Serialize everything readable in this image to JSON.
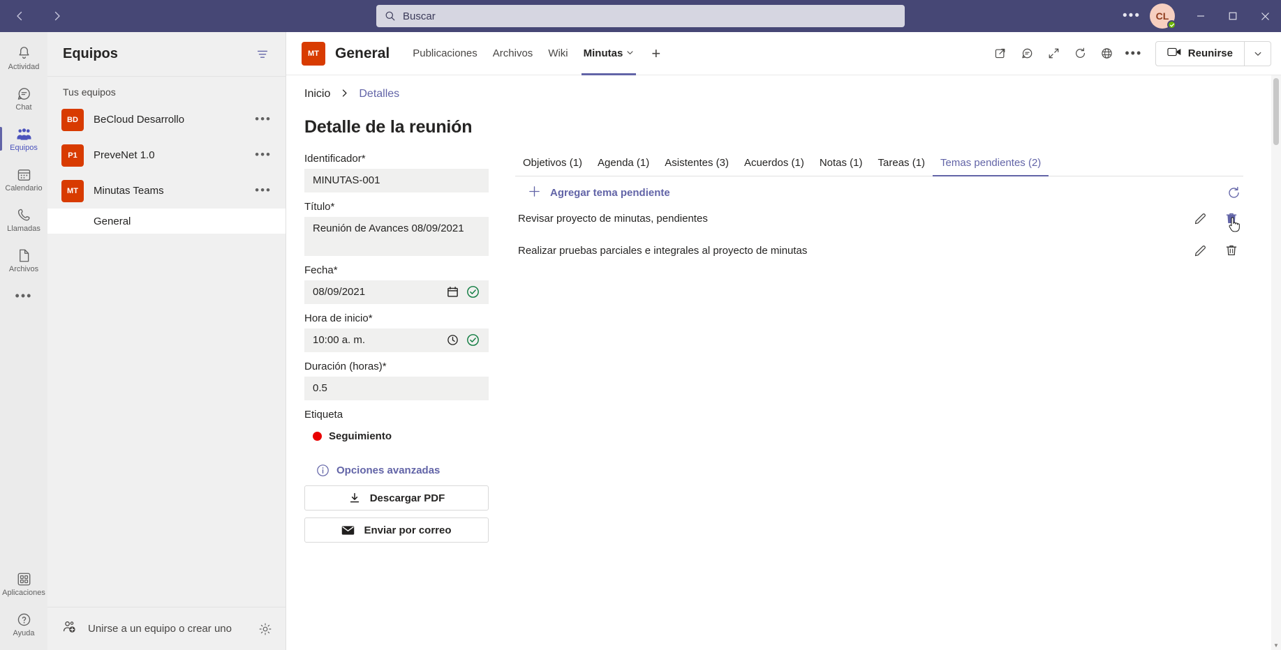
{
  "titlebar": {
    "back_icon": "chevron-left-icon",
    "forward_icon": "chevron-right-icon",
    "search_placeholder": "Buscar",
    "more_label": "•••",
    "avatar_initials": "CL",
    "presence": "available",
    "minimize_label": "—",
    "maximize_label": "□",
    "close_label": "✕"
  },
  "rail": {
    "items": [
      {
        "label": "Actividad",
        "icon": "bell-icon",
        "active": false
      },
      {
        "label": "Chat",
        "icon": "chat-icon",
        "active": false
      },
      {
        "label": "Equipos",
        "icon": "people-icon",
        "active": true
      },
      {
        "label": "Calendario",
        "icon": "calendar-icon",
        "active": false
      },
      {
        "label": "Llamadas",
        "icon": "phone-icon",
        "active": false
      },
      {
        "label": "Archivos",
        "icon": "file-icon",
        "active": false
      }
    ],
    "more_label": "•••",
    "bottom": [
      {
        "label": "Aplicaciones",
        "icon": "apps-icon"
      },
      {
        "label": "Ayuda",
        "icon": "help-icon"
      }
    ]
  },
  "teams": {
    "title": "Equipos",
    "filter_icon": "filter-icon",
    "section_label": "Tus equipos",
    "list": [
      {
        "initials": "BD",
        "name": "BeCloud Desarrollo",
        "more": "•••"
      },
      {
        "initials": "P1",
        "name": "PreveNet 1.0",
        "more": "•••"
      },
      {
        "initials": "MT",
        "name": "Minutas Teams",
        "more": "•••"
      }
    ],
    "channel": "General",
    "join_label": "Unirse a un equipo o crear uno",
    "join_icon": "add-people-icon",
    "settings_icon": "gear-icon"
  },
  "channel_header": {
    "avatar_initials": "MT",
    "title": "General",
    "tabs": [
      {
        "label": "Publicaciones",
        "active": false,
        "caret": false
      },
      {
        "label": "Archivos",
        "active": false,
        "caret": false
      },
      {
        "label": "Wiki",
        "active": false,
        "caret": false
      },
      {
        "label": "Minutas",
        "active": true,
        "caret": true
      }
    ],
    "add_tab_label": "+",
    "actions": [
      "open-in-new-icon",
      "conversation-icon",
      "expand-icon",
      "refresh-icon",
      "globe-icon"
    ],
    "more_label": "•••",
    "meet_label": "Reunirse",
    "meet_icon": "video-camera-icon",
    "meet_caret": "∨"
  },
  "page": {
    "breadcrumb": {
      "home": "Inicio",
      "separator": "›",
      "current": "Detalles"
    },
    "title": "Detalle de la reunión"
  },
  "form": {
    "fields": [
      {
        "label": "Identificador*",
        "value": "MINUTAS-001",
        "icon": null,
        "check": false,
        "tall": false
      },
      {
        "label": "Título*",
        "value": "Reunión  de Avances 08/09/2021",
        "icon": null,
        "check": false,
        "tall": true
      },
      {
        "label": "Fecha*",
        "value": "08/09/2021",
        "icon": "calendar-icon",
        "check": true,
        "tall": false
      },
      {
        "label": "Hora de inicio*",
        "value": "10:00  a. m.",
        "icon": "clock-icon",
        "check": true,
        "tall": false
      },
      {
        "label": "Duración (horas)*",
        "value": "0.5",
        "icon": null,
        "check": false,
        "tall": false
      }
    ],
    "tag_label": "Etiqueta",
    "tag_value": "Seguimiento",
    "tag_color": "#e90000",
    "advanced_label": "Opciones avanzadas",
    "advanced_icon": "info-icon",
    "buttons": [
      {
        "label": "Descargar PDF",
        "icon": "download-icon"
      },
      {
        "label": "Enviar por correo",
        "icon": "mail-icon"
      }
    ]
  },
  "panel": {
    "tabs": [
      {
        "label": "Objetivos (1)",
        "active": false
      },
      {
        "label": "Agenda (1)",
        "active": false
      },
      {
        "label": "Asistentes (3)",
        "active": false
      },
      {
        "label": "Acuerdos (1)",
        "active": false
      },
      {
        "label": "Notas (1)",
        "active": false
      },
      {
        "label": "Tareas (1)",
        "active": false
      },
      {
        "label": "Temas pendientes (2)",
        "active": true
      }
    ],
    "add_label": "Agregar tema pendiente",
    "add_icon": "plus-icon",
    "refresh_icon": "refresh-icon",
    "items": [
      {
        "text": "Revisar proyecto de minutas, pendientes",
        "edit_icon": "pencil-icon",
        "delete_icon": "trash-icon",
        "delete_hover": true
      },
      {
        "text": "Realizar pruebas parciales e integrales al proyecto de minutas",
        "edit_icon": "pencil-icon",
        "delete_icon": "trash-icon",
        "delete_hover": false
      }
    ]
  },
  "colors": {
    "brand_purple": "#6264a7",
    "titlebar": "#464775",
    "team_avatar": "#d83b01",
    "check_green": "#107c41"
  }
}
